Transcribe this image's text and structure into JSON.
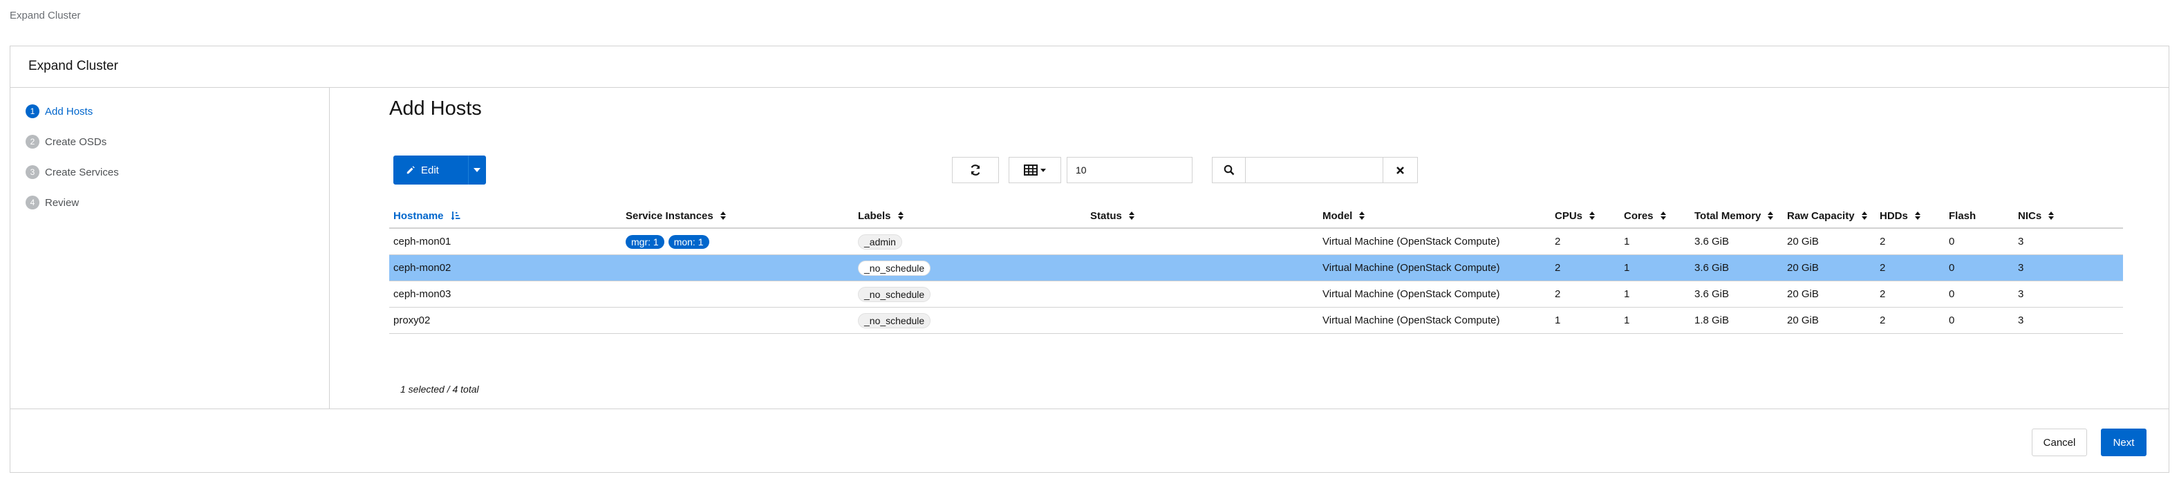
{
  "breadcrumb": "Expand Cluster",
  "card": {
    "title": "Expand Cluster"
  },
  "wizard": {
    "steps": [
      {
        "num": "1",
        "label": "Add Hosts"
      },
      {
        "num": "2",
        "label": "Create OSDs"
      },
      {
        "num": "3",
        "label": "Create Services"
      },
      {
        "num": "4",
        "label": "Review"
      }
    ],
    "active_step": 0
  },
  "page": {
    "title": "Add Hosts"
  },
  "toolbar": {
    "edit_label": "Edit",
    "page_size": "10",
    "search_value": "",
    "icons": {
      "edit": "pencil-icon",
      "dropdown": "caret-down-icon",
      "refresh": "refresh-icon",
      "columns": "table-columns-icon",
      "search": "search-icon",
      "clear": "close-icon"
    }
  },
  "table": {
    "headers": {
      "hostname": "Hostname",
      "service_instances": "Service Instances",
      "labels": "Labels",
      "status": "Status",
      "model": "Model",
      "cpus": "CPUs",
      "cores": "Cores",
      "total_memory": "Total Memory",
      "raw_capacity": "Raw Capacity",
      "hdds": "HDDs",
      "flash": "Flash",
      "nics": "NICs"
    },
    "rows": [
      {
        "hostname": "ceph-mon01",
        "services": [
          "mgr: 1",
          "mon: 1"
        ],
        "label": "_admin",
        "status": "",
        "model": "Virtual Machine (OpenStack Compute)",
        "cpus": "2",
        "cores": "1",
        "memory": "3.6 GiB",
        "capacity": "20 GiB",
        "hdds": "2",
        "flash": "0",
        "nics": "3",
        "selected": false
      },
      {
        "hostname": "ceph-mon02",
        "services": [],
        "label": "_no_schedule",
        "status": "",
        "model": "Virtual Machine (OpenStack Compute)",
        "cpus": "2",
        "cores": "1",
        "memory": "3.6 GiB",
        "capacity": "20 GiB",
        "hdds": "2",
        "flash": "0",
        "nics": "3",
        "selected": true
      },
      {
        "hostname": "ceph-mon03",
        "services": [],
        "label": "_no_schedule",
        "status": "",
        "model": "Virtual Machine (OpenStack Compute)",
        "cpus": "2",
        "cores": "1",
        "memory": "3.6 GiB",
        "capacity": "20 GiB",
        "hdds": "2",
        "flash": "0",
        "nics": "3",
        "selected": false
      },
      {
        "hostname": "proxy02",
        "services": [],
        "label": "_no_schedule",
        "status": "",
        "model": "Virtual Machine (OpenStack Compute)",
        "cpus": "1",
        "cores": "1",
        "memory": "1.8 GiB",
        "capacity": "20 GiB",
        "hdds": "2",
        "flash": "0",
        "nics": "3",
        "selected": false
      }
    ],
    "footer": "1 selected / 4 total"
  },
  "footer": {
    "cancel_label": "Cancel",
    "next_label": "Next"
  },
  "colors": {
    "primary": "#0066cc",
    "selected_row": "#8bc1f7",
    "border": "#d2d2d2",
    "step_inactive": "#b8bbbe"
  }
}
